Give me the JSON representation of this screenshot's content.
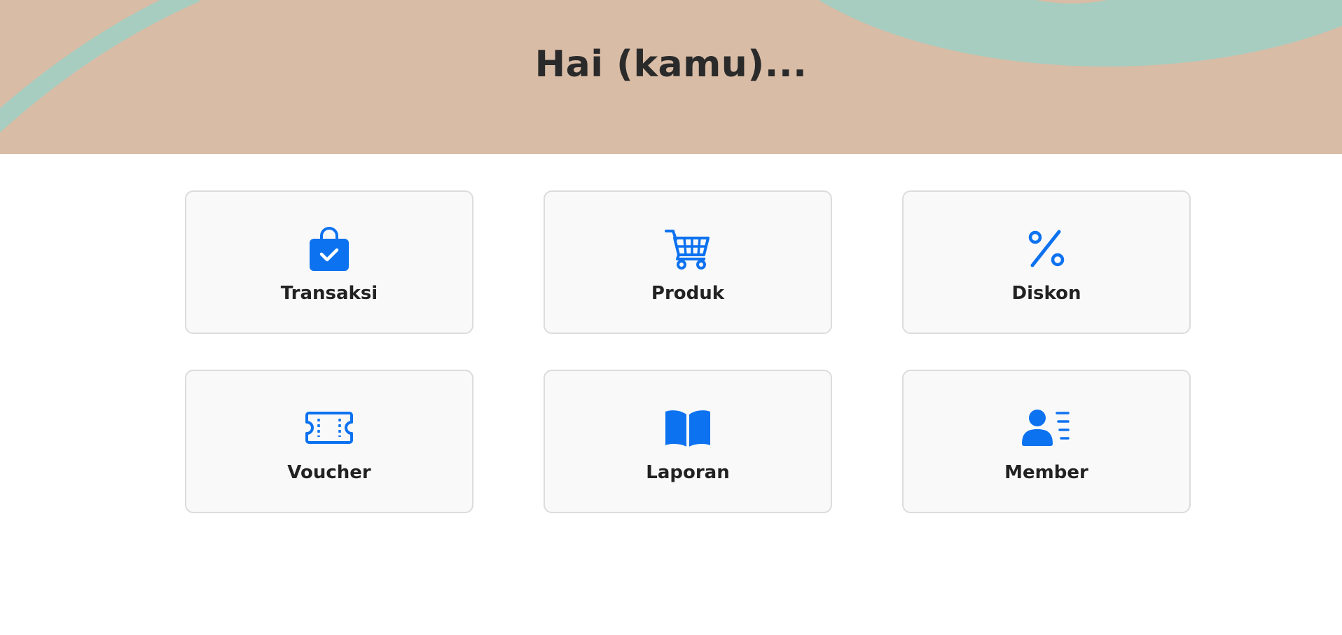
{
  "header": {
    "title": "Hai (kamu)...",
    "background_color": "#d9bca6",
    "wave_color": "#a6cdc0"
  },
  "accent_color": "#0d72f0",
  "menu": {
    "items": [
      {
        "label": "Transaksi",
        "icon": "shopping-bag-check-icon"
      },
      {
        "label": "Produk",
        "icon": "shopping-cart-icon"
      },
      {
        "label": "Diskon",
        "icon": "percent-icon"
      },
      {
        "label": "Voucher",
        "icon": "ticket-icon"
      },
      {
        "label": "Laporan",
        "icon": "open-book-icon"
      },
      {
        "label": "Member",
        "icon": "person-lines-icon"
      }
    ]
  }
}
